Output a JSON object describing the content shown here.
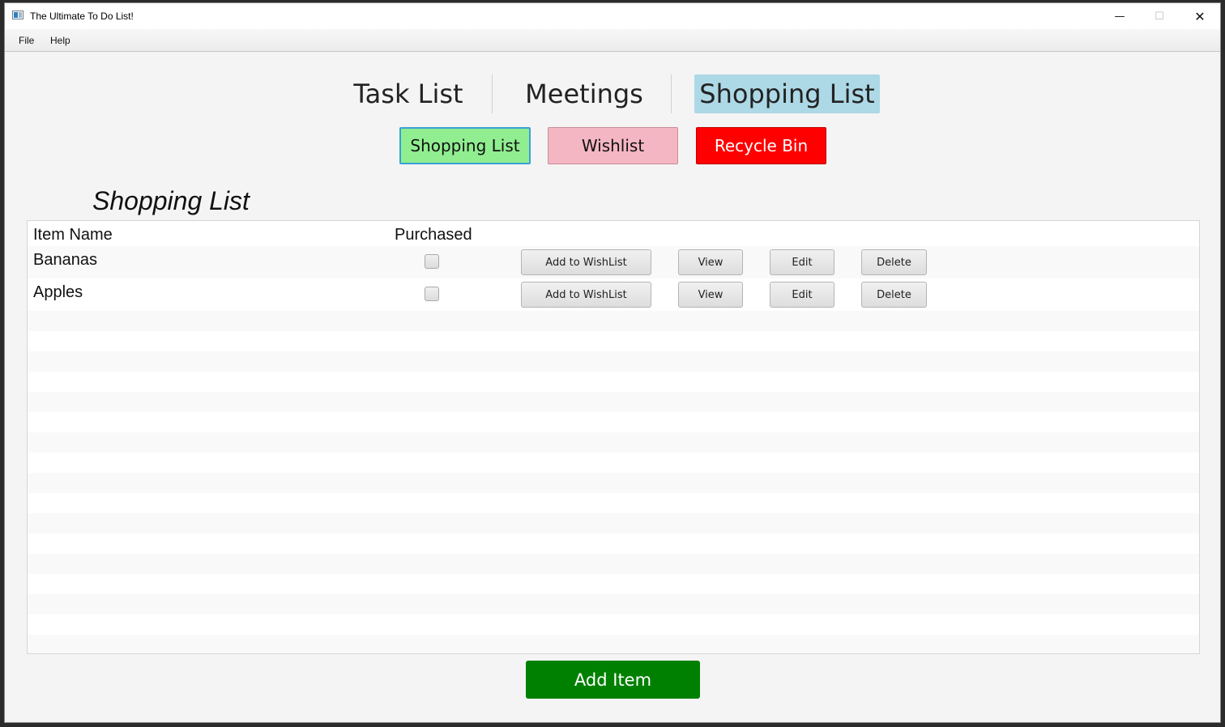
{
  "window": {
    "title": "The Ultimate To Do List!",
    "controls": {
      "minimize": "—",
      "maximize": "☐",
      "close": "✕"
    }
  },
  "menu": [
    "File",
    "Help"
  ],
  "tabs": [
    {
      "label": "Task List",
      "active": false
    },
    {
      "label": "Meetings",
      "active": false
    },
    {
      "label": "Shopping List",
      "active": true
    }
  ],
  "sub_buttons": [
    {
      "label": "Shopping List",
      "color": "#90ee90"
    },
    {
      "label": "Wishlist",
      "color": "#f4b6c2"
    },
    {
      "label": "Recycle Bin",
      "color": "#ff0000"
    }
  ],
  "section_title": "Shopping List",
  "table": {
    "columns": [
      "Item Name",
      "Purchased"
    ],
    "rows": [
      {
        "name": "Bananas",
        "purchased": false,
        "actions": [
          "Add to WishList",
          "View",
          "Edit",
          "Delete"
        ]
      },
      {
        "name": "Apples",
        "purchased": false,
        "actions": [
          "Add to WishList",
          "View",
          "Edit",
          "Delete"
        ]
      }
    ]
  },
  "add_item_label": "Add Item",
  "colors": {
    "active_tab": "#add8e6",
    "add_item": "#008000"
  }
}
